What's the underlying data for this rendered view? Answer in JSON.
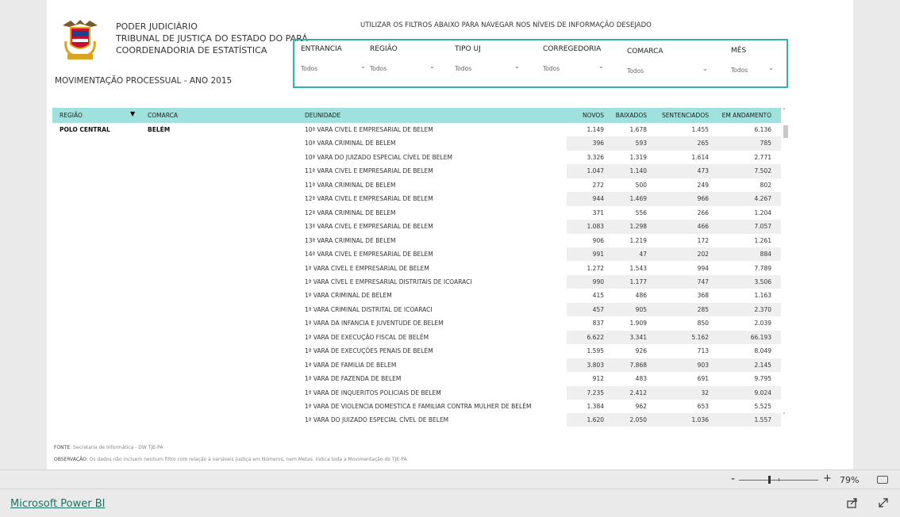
{
  "header": {
    "org_lines": [
      "PODER JUDICIÁRIO",
      "TRIBUNAL DE JUSTIÇA DO ESTADO DO PARÁ",
      "COORDENADORIA DE ESTATÍSTICA"
    ],
    "report_title": "MOVIMENTAÇÃO PROCESSUAL - ANO 2015",
    "filter_hint": "UTILIZAR OS FILTROS ABAIXO PARA NAVEGAR NOS NÍVEIS DE INFORMAÇÃO DESEJADO"
  },
  "filters": [
    {
      "label": "ENTRANCIA",
      "value": "Todos"
    },
    {
      "label": "REGIÃO",
      "value": "Todos"
    },
    {
      "label": "TIPO UJ",
      "value": "Todos"
    },
    {
      "label": "CORREGEDORIA",
      "value": "Todos"
    },
    {
      "label": "COMARCA",
      "value": "Todos"
    },
    {
      "label": "MÊS",
      "value": "Todos"
    }
  ],
  "table": {
    "columns": [
      "REGIÃO",
      "COMARCA",
      "DEUNIDADE",
      "NOVOS",
      "BAIXADOS",
      "SENTENCIADOS",
      "EM ANDAMENTO"
    ],
    "group_regiao": "POLO CENTRAL",
    "group_comarca": "BELÉM",
    "rows": [
      {
        "unidade": "10ª VARA CIVEL E EMPRESARIAL DE BELEM",
        "novos": "1.149",
        "baixados": "1.678",
        "sentenciados": "1.455",
        "andamento": "6.136"
      },
      {
        "unidade": "10ª VARA CRIMINAL DE BELEM",
        "novos": "396",
        "baixados": "593",
        "sentenciados": "265",
        "andamento": "785"
      },
      {
        "unidade": "10ª VARA DO JUIZADO ESPECIAL CÍVEL DE BELEM",
        "novos": "3.326",
        "baixados": "1.319",
        "sentenciados": "1.614",
        "andamento": "2.771"
      },
      {
        "unidade": "11ª VARA CIVEL E EMPRESARIAL DE BELEM",
        "novos": "1.047",
        "baixados": "1.140",
        "sentenciados": "473",
        "andamento": "7.502"
      },
      {
        "unidade": "11ª VARA CRIMINAL DE BELEM",
        "novos": "272",
        "baixados": "500",
        "sentenciados": "249",
        "andamento": "802"
      },
      {
        "unidade": "12ª VARA CIVEL E EMPRESARIAL DE BELEM",
        "novos": "944",
        "baixados": "1.469",
        "sentenciados": "966",
        "andamento": "4.267"
      },
      {
        "unidade": "12ª VARA CRIMINAL DE BELEM",
        "novos": "371",
        "baixados": "556",
        "sentenciados": "266",
        "andamento": "1.204"
      },
      {
        "unidade": "13ª VARA CIVEL E EMPRESARIAL DE BELEM",
        "novos": "1.083",
        "baixados": "1.298",
        "sentenciados": "466",
        "andamento": "7.057"
      },
      {
        "unidade": "13ª VARA CRIMINAL DE BELEM",
        "novos": "906",
        "baixados": "1.219",
        "sentenciados": "172",
        "andamento": "1.261"
      },
      {
        "unidade": "14ª VARA CIVEL E EMPRESARIAL DE BELEM",
        "novos": "991",
        "baixados": "47",
        "sentenciados": "202",
        "andamento": "884"
      },
      {
        "unidade": "1ª VARA CIVEL E EMPRESARIAL DE BELEM",
        "novos": "1.272",
        "baixados": "1.543",
        "sentenciados": "994",
        "andamento": "7.789"
      },
      {
        "unidade": "1ª VARA CÍVEL E EMPRESARIAL DISTRITAIS DE ICOARACI",
        "novos": "990",
        "baixados": "1.177",
        "sentenciados": "747",
        "andamento": "3.506"
      },
      {
        "unidade": "1ª VARA CRIMINAL DE BELEM",
        "novos": "415",
        "baixados": "486",
        "sentenciados": "368",
        "andamento": "1.163"
      },
      {
        "unidade": "1ª VARA CRIMINAL DISTRITAL DE ICOARACI",
        "novos": "457",
        "baixados": "905",
        "sentenciados": "285",
        "andamento": "2.370"
      },
      {
        "unidade": "1ª VARA DA INFANCIA E JUVENTUDE DE BELEM",
        "novos": "837",
        "baixados": "1.909",
        "sentenciados": "850",
        "andamento": "2.039"
      },
      {
        "unidade": "1ª VARA DE EXECUÇÃO FISCAL DE BELÉM",
        "novos": "6.622",
        "baixados": "3.341",
        "sentenciados": "5.162",
        "andamento": "66.193"
      },
      {
        "unidade": "1ª VARA DE EXECUÇÕES PENAIS DE BELÉM",
        "novos": "1.595",
        "baixados": "926",
        "sentenciados": "713",
        "andamento": "8.049"
      },
      {
        "unidade": "1ª VARA DE FAMILIA DE BELEM",
        "novos": "3.803",
        "baixados": "7.868",
        "sentenciados": "903",
        "andamento": "2.145"
      },
      {
        "unidade": "1ª VARA DE FAZENDA DE BELEM",
        "novos": "912",
        "baixados": "483",
        "sentenciados": "691",
        "andamento": "9.795"
      },
      {
        "unidade": "1ª VARA DE INQUERITOS POLICIAIS DE BELEM",
        "novos": "7.235",
        "baixados": "2.412",
        "sentenciados": "32",
        "andamento": "9.024"
      },
      {
        "unidade": "1ª VARA DE VIOLENCIA DOMESTICA E FAMILIAR CONTRA MULHER DE BELÉM",
        "novos": "1.384",
        "baixados": "962",
        "sentenciados": "653",
        "andamento": "5.525"
      },
      {
        "unidade": "1ª VARA DO JUIZADO ESPECIAL CÍVEL DE BELEM",
        "novos": "1.620",
        "baixados": "2.050",
        "sentenciados": "1.036",
        "andamento": "1.557"
      }
    ]
  },
  "footer": {
    "fonte_label": "FONTE",
    "fonte_text": ": Secretaria de Informática - DW TJE-PA",
    "obs_label": "OBSERVAÇÃO",
    "obs_text": ": Os dados não incluem nenhum filtro com relação à variáveis Justiça em Números, nem Metas. Indica toda a Movimentação do TJE-PA"
  },
  "zoom": {
    "minus": "-",
    "plus": "+",
    "percent": "79%"
  },
  "bottom": {
    "link_label": "Microsoft Power BI"
  },
  "icons": [
    "court-crest-icon",
    "chevron-down-icon",
    "sort-desc-icon",
    "scroll-up-icon",
    "scroll-down-icon",
    "fit-page-icon",
    "share-icon",
    "expand-icon"
  ],
  "colors": {
    "accent": "#2bb5a8",
    "header_bg": "#9fe1dc",
    "stripe": "#efefef",
    "link": "#1f6f63"
  }
}
